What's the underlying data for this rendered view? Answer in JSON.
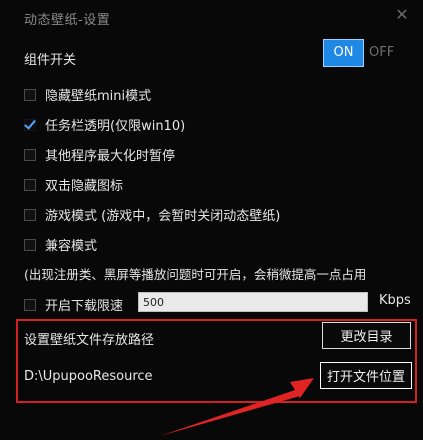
{
  "window": {
    "title": "动态壁纸-设置",
    "close_glyph": "✕"
  },
  "widget_switch": {
    "label": "组件开关",
    "on_label": "ON",
    "off_label": "OFF",
    "state": "ON"
  },
  "options": [
    {
      "label": "隐藏壁纸mini模式",
      "checked": false
    },
    {
      "label": "任务栏透明(仅限win10)",
      "checked": true
    },
    {
      "label": "其他程序最大化时暂停",
      "checked": false
    },
    {
      "label": "双击隐藏图标",
      "checked": false
    },
    {
      "label": "游戏模式 (游戏中，会暂时关闭动态壁纸)",
      "checked": false
    },
    {
      "label": "兼容模式",
      "checked": false
    }
  ],
  "compat_note": "(出现注册类、黑屏等播放问题时可开启，会稍微提高一点占用",
  "download_limit": {
    "label": "开启下载限速",
    "checked": false,
    "value": "500",
    "unit": "Kbps"
  },
  "storage": {
    "label": "设置壁纸文件存放路径",
    "change_button": "更改目录",
    "path": "D:\\UpupooResource",
    "open_button": "打开文件位置"
  },
  "colors": {
    "accent": "#1e88e5",
    "highlight": "#d32020",
    "check": "#4fa6ff"
  }
}
